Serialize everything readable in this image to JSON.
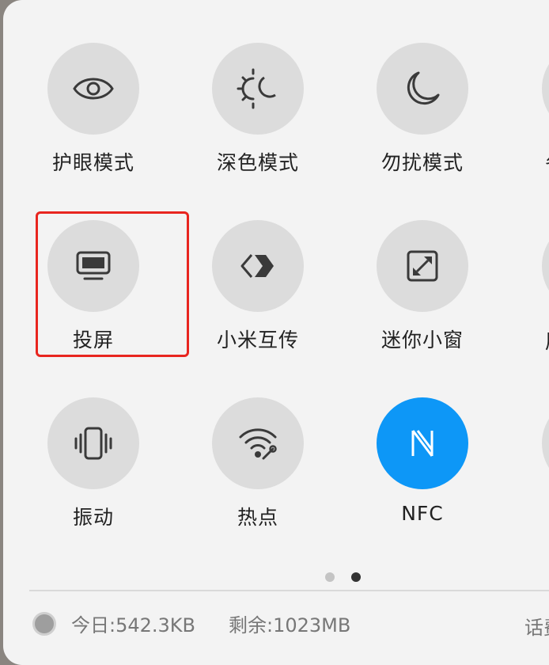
{
  "tiles": [
    {
      "label": "护眼模式",
      "icon": "eye-icon",
      "active": false
    },
    {
      "label": "深色模式",
      "icon": "sun-moon-icon",
      "active": false
    },
    {
      "label": "勿扰模式",
      "icon": "moon-icon",
      "active": false
    },
    {
      "label": "投屏",
      "icon": "screen-cast-icon",
      "active": false,
      "highlighted": true
    },
    {
      "label": "小米互传",
      "icon": "xiaomi-share-icon",
      "active": false
    },
    {
      "label": "迷你小窗",
      "icon": "mini-window-icon",
      "active": false
    },
    {
      "label": "振动",
      "icon": "vibrate-icon",
      "active": false
    },
    {
      "label": "热点",
      "icon": "hotspot-icon",
      "active": false
    },
    {
      "label": "NFC",
      "icon": "nfc-icon",
      "active": true
    }
  ],
  "partial_labels": {
    "row1": "省",
    "row2": "屏"
  },
  "pager": {
    "total": 2,
    "current": 2
  },
  "footer": {
    "today": "今日:542.3KB",
    "remaining": "剩余:1023MB",
    "right": "话费"
  },
  "colors": {
    "panel_bg": "#f3f3f3",
    "tile_bg": "#dcdcdc",
    "active_bg": "#0d97f7",
    "highlight": "#e8251f"
  }
}
